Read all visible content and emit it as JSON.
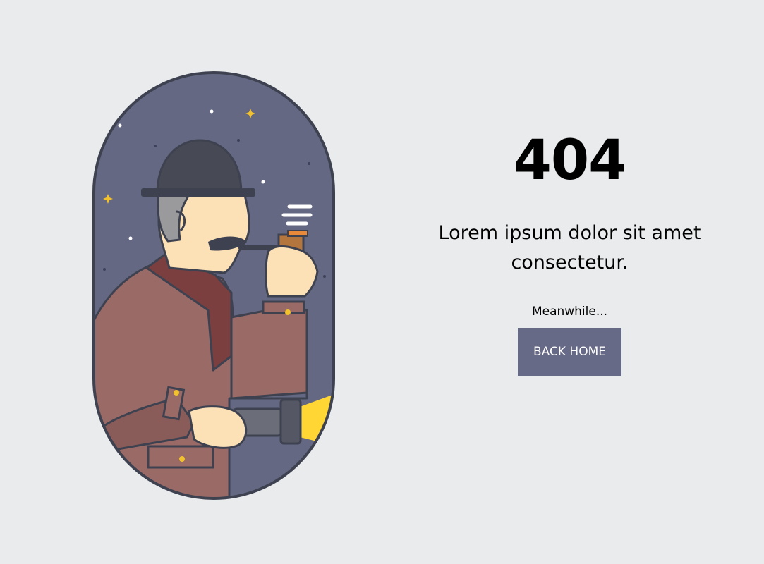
{
  "error": {
    "code": "404",
    "message": "Lorem ipsum dolor sit amet consectetur.",
    "meanwhile": "Meanwhile...",
    "button_label": "BACK HOME"
  },
  "colors": {
    "background": "#EAEBED",
    "button": "#676A87",
    "button_text": "#FFFFFF",
    "night_sky": "#646882",
    "coat": "#9A6A67",
    "collar": "#7A3F3E",
    "hat": "#474A54",
    "skin": "#FCE0B6",
    "hair": "#9A9A9C",
    "moon": "#FFFFFF",
    "star": "#F2C12E",
    "flashlight_beam": "#FFD633"
  },
  "illustration": {
    "icon": "detective-icon"
  }
}
